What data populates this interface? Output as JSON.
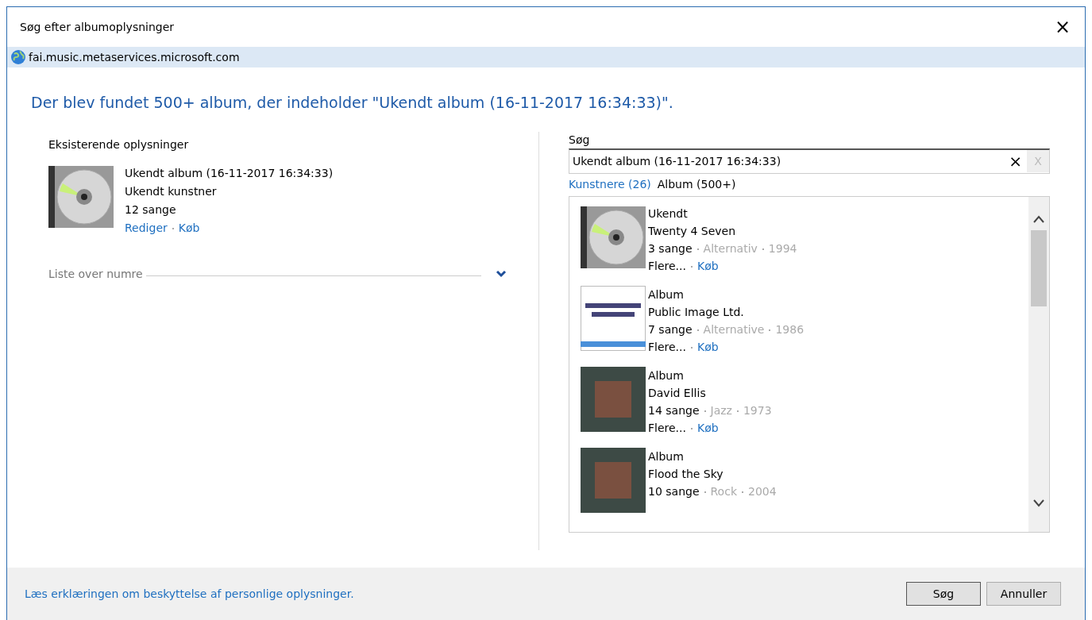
{
  "window": {
    "title": "Søg efter albumoplysninger",
    "close": "×"
  },
  "address_bar": {
    "url": "fai.music.metaservices.microsoft.com"
  },
  "heading": "Der blev fundet 500+ album, der indeholder \"Ukendt album (16-11-2017 16:34:33)\".",
  "existing": {
    "label": "Eksisterende oplysninger",
    "cover": {
      "kind": "cd"
    },
    "lines": [
      "Ukendt album (16-11-2017 16:34:33)",
      "Ukendt kunstner",
      "12 sange"
    ],
    "links": [
      "Rediger",
      "Køb"
    ],
    "tracklist": {
      "label": "Liste over numre",
      "expanded": false
    }
  },
  "search": {
    "label": "Søg",
    "value": "Ukendt album (16-11-2017 16:34:33)",
    "clear": "×",
    "cancel": "X"
  },
  "result_tabs": [
    {
      "label": "Kunstnere (26)",
      "selected": false
    },
    {
      "label": "Album (500+)",
      "selected": true
    }
  ],
  "results": [
    {
      "cover": {
        "kind": "cd"
      },
      "type": "Ukendt",
      "title": "Twenty 4 Seven",
      "songs": "3 sange",
      "genre": "Alternativ",
      "year": "1994",
      "links": [
        "Flere...",
        "Køb"
      ]
    },
    {
      "cover": {
        "kind": "compact"
      },
      "type": "Album",
      "title": "Public Image Ltd.",
      "songs": "7 sange",
      "genre": "Alternative",
      "year": "1986",
      "links": [
        "Flere...",
        "Køb"
      ]
    },
    {
      "cover": {
        "kind": "photo"
      },
      "type": "Album",
      "title": "David Ellis",
      "songs": "14 sange",
      "genre": "Jazz",
      "year": "1973",
      "links": [
        "Flere...",
        "Køb"
      ]
    },
    {
      "cover": {
        "kind": "photo"
      },
      "type": "Album",
      "title": "Flood the Sky",
      "songs": "10 sange",
      "genre": "Rock",
      "year": "2004"
    }
  ],
  "footer": {
    "privacy_link": "Læs erklæringen om beskyttelse af personlige oplysninger.",
    "buttons": [
      "Søg",
      "Annuller"
    ]
  }
}
